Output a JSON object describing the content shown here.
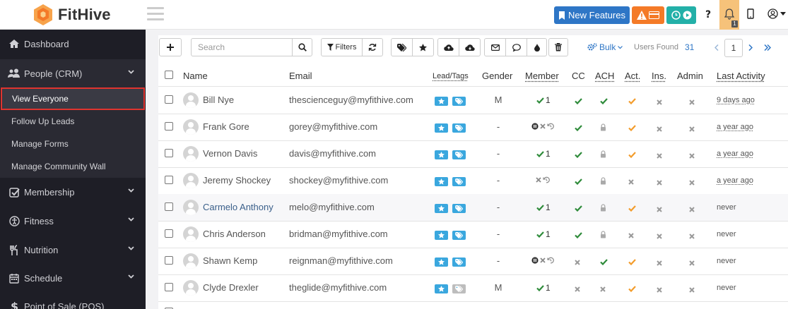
{
  "app": {
    "name": "FitHive",
    "new_features_label": "New Features",
    "notification_count": "1"
  },
  "sidebar": {
    "items": [
      {
        "label": "Dashboard",
        "icon": "home-icon"
      },
      {
        "label": "People (CRM)",
        "icon": "users-icon"
      },
      {
        "label": "Membership",
        "icon": "check-square-icon"
      },
      {
        "label": "Fitness",
        "icon": "universal-access-icon"
      },
      {
        "label": "Nutrition",
        "icon": "utensils-icon"
      },
      {
        "label": "Schedule",
        "icon": "calendar-icon"
      },
      {
        "label": "Point of Sale (POS)",
        "icon": "dollar-icon"
      }
    ],
    "subitems": [
      {
        "label": "View Everyone",
        "active": true
      },
      {
        "label": "Follow Up Leads"
      },
      {
        "label": "Manage Forms"
      },
      {
        "label": "Manage Community Wall"
      }
    ]
  },
  "toolbar": {
    "search_placeholder": "Search",
    "filters_label": "Filters",
    "bulk_label": "Bulk",
    "users_found_label": "Users Found",
    "users_found_count": "31",
    "page": "1"
  },
  "table": {
    "headers": [
      "Name",
      "Email",
      "Lead/Tags",
      "Gender",
      "Member",
      "CC",
      "ACH",
      "Act.",
      "Ins.",
      "Admin",
      "Last Activity"
    ],
    "rows": [
      {
        "name": "Bill Nye",
        "email": "thescienceguy@myfithive.com",
        "gender": "M",
        "member": "1",
        "member_type": "check",
        "cc": "check",
        "ach": "check",
        "act": "warn",
        "ins": "x",
        "admin": "x",
        "last": "9 days ago",
        "tag2_grey": false,
        "name_link": false
      },
      {
        "name": "Frank Gore",
        "email": "gorey@myfithive.com",
        "gender": "-",
        "member": "",
        "member_type": "pause",
        "cc": "check",
        "ach": "lock",
        "act": "warn",
        "ins": "x",
        "admin": "x",
        "last": "a year ago",
        "tag2_grey": false,
        "name_link": false
      },
      {
        "name": "Vernon Davis",
        "email": "davis@myfithive.com",
        "gender": "-",
        "member": "1",
        "member_type": "check",
        "cc": "check",
        "ach": "lock",
        "act": "warn",
        "ins": "x",
        "admin": "x",
        "last": "a year ago",
        "tag2_grey": false,
        "name_link": false
      },
      {
        "name": "Jeremy Shockey",
        "email": "shockey@myfithive.com",
        "gender": "-",
        "member": "",
        "member_type": "expired",
        "cc": "check",
        "ach": "lock",
        "act": "x",
        "ins": "x",
        "admin": "x",
        "last": "a year ago",
        "tag2_grey": false,
        "name_link": false
      },
      {
        "name": "Carmelo Anthony",
        "email": "melo@myfithive.com",
        "gender": "-",
        "member": "1",
        "member_type": "check",
        "cc": "check",
        "ach": "lock",
        "act": "warn",
        "ins": "x",
        "admin": "x",
        "last": "never",
        "tag2_grey": false,
        "name_link": true
      },
      {
        "name": "Chris Anderson",
        "email": "bridman@myfithive.com",
        "gender": "-",
        "member": "1",
        "member_type": "check",
        "cc": "check",
        "ach": "lock",
        "act": "x",
        "ins": "x",
        "admin": "x",
        "last": "never",
        "tag2_grey": false,
        "name_link": false
      },
      {
        "name": "Shawn Kemp",
        "email": "reignman@myfithive.com",
        "gender": "-",
        "member": "",
        "member_type": "pause",
        "cc": "x",
        "ach": "check",
        "act": "warn",
        "ins": "x",
        "admin": "x",
        "last": "never",
        "tag2_grey": false,
        "name_link": false
      },
      {
        "name": "Clyde Drexler",
        "email": "theglide@myfithive.com",
        "gender": "M",
        "member": "1",
        "member_type": "check",
        "cc": "x",
        "ach": "x",
        "act": "warn",
        "ins": "x",
        "admin": "x",
        "last": "never",
        "tag2_grey": true,
        "name_link": false
      }
    ]
  },
  "colors": {
    "primary": "#2e76c6",
    "warning": "#f47a27",
    "teal": "#23b0a8",
    "sidebar_bg": "#1e1e26",
    "active_outline": "#e0342f",
    "tag_blue": "#3aa7de",
    "check_green": "#2e8b3a",
    "act_orange": "#f39c2b"
  }
}
